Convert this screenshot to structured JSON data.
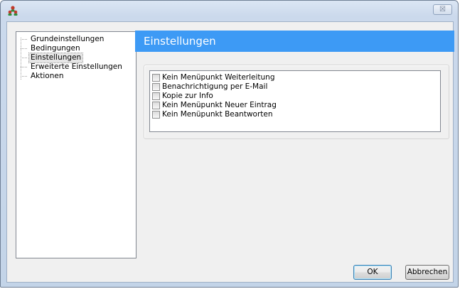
{
  "window": {
    "close_glyph": "☒",
    "app_icon": "users-group-icon"
  },
  "tree": {
    "items": [
      {
        "label": "Grundeinstellungen",
        "selected": false
      },
      {
        "label": "Bedingungen",
        "selected": false
      },
      {
        "label": "Einstellungen",
        "selected": true
      },
      {
        "label": "Erweiterte Einstellungen",
        "selected": false
      },
      {
        "label": "Aktionen",
        "selected": false
      }
    ]
  },
  "panel": {
    "title": "Einstellungen",
    "header_color": "#3d9af5",
    "options": [
      {
        "label": "Kein Menüpunkt Weiterleitung",
        "checked": false
      },
      {
        "label": "Benachrichtigung per E-Mail",
        "checked": false
      },
      {
        "label": "Kopie zur Info",
        "checked": false
      },
      {
        "label": "Kein Menüpunkt Neuer Eintrag",
        "checked": false
      },
      {
        "label": "Kein Menüpunkt Beantworten",
        "checked": false
      }
    ]
  },
  "buttons": {
    "ok": "OK",
    "cancel": "Abbrechen"
  }
}
